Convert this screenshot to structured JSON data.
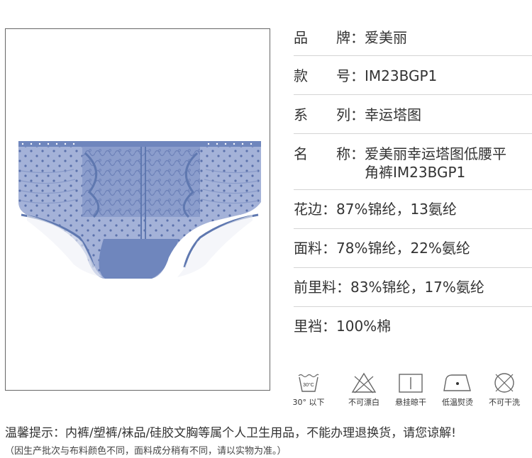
{
  "specs": [
    {
      "label": "品　　牌：",
      "value": "爱美丽"
    },
    {
      "label": "款　　号：",
      "value": "IM23BGP1"
    },
    {
      "label": "系　　列：",
      "value": "幸运塔图"
    },
    {
      "label": "名　　称：",
      "value": "爱美丽幸运塔图低腰平角裤IM23BGP1"
    },
    {
      "label": "花边：",
      "value": "87%锦纶，13氨纶"
    },
    {
      "label": "面料：",
      "value": "78%锦纶，22%氨纶"
    },
    {
      "label": "前里料：",
      "value": "83%锦纶，17%氨纶"
    },
    {
      "label": "里裆：",
      "value": "100%棉"
    }
  ],
  "care": [
    {
      "icon": "wash-30-icon",
      "temp": "30°C",
      "label": "30° 以下"
    },
    {
      "icon": "no-bleach-icon",
      "label": "不可漂白"
    },
    {
      "icon": "hang-dry-icon",
      "label": "悬挂晾干"
    },
    {
      "icon": "low-iron-icon",
      "label": "低温熨烫"
    },
    {
      "icon": "no-dry-clean-icon",
      "label": "不可干洗"
    }
  ],
  "notice": "温馨提示：内裤/塑裤/袜品/硅胶文胸等属个人卫生用品，不能办理退换货，请您谅解!",
  "subnotice": "（因生产批次与布料颜色不同，面料成分稍有不同，请以实物为准。）",
  "colors": {
    "fabric": "#7c91c4",
    "fabric_dark": "#5f78b0",
    "lace": "#8ea0cc",
    "border": "#666666",
    "divider": "#d4d4d4"
  }
}
